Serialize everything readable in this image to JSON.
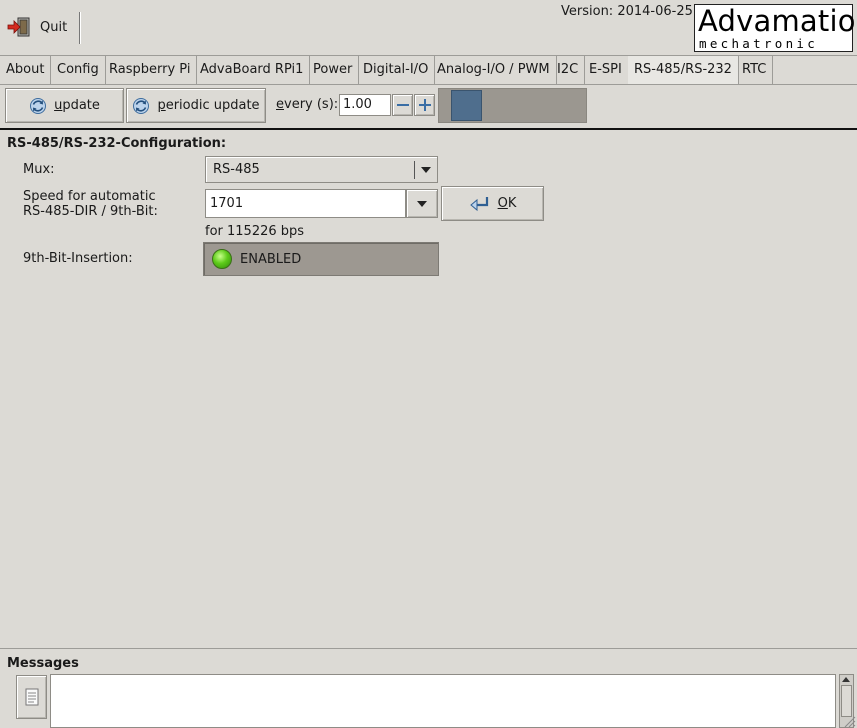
{
  "toolbar": {
    "quit_label": "Quit",
    "version": "Version: 2014-06-25",
    "logo_line1": "Advamation",
    "logo_line2": "mechatronic"
  },
  "tabs": [
    {
      "label": "About"
    },
    {
      "label": "Config"
    },
    {
      "label": "Raspberry Pi"
    },
    {
      "label": "AdvaBoard RPi1"
    },
    {
      "label": "Power"
    },
    {
      "label": "Digital-I/O"
    },
    {
      "label": "Analog-I/O / PWM"
    },
    {
      "label": "I2C"
    },
    {
      "label": "E-SPI"
    },
    {
      "label": "RS-485/RS-232",
      "active": true
    },
    {
      "label": "RTC"
    }
  ],
  "update_bar": {
    "update_label": "update",
    "periodic_label": "periodic update",
    "every_label": "every (s):",
    "interval_value": "1.00",
    "slider_level": 0.1
  },
  "config": {
    "section_title": "RS-485/RS-232-Configuration:",
    "mux_label": "Mux:",
    "mux_value": "RS-485",
    "speed_label_line1": "Speed for automatic",
    "speed_label_line2": "RS-485-DIR / 9th-Bit:",
    "speed_value": "1701",
    "ok_label": "OK",
    "bps_text": "for 115226 bps",
    "ninth_bit_label": "9th-Bit-Insertion:",
    "ninth_bit_state": "ENABLED"
  },
  "messages": {
    "title": "Messages",
    "text": ""
  },
  "colors": {
    "background": "#dcdad5",
    "slider_knob": "#4f6e8d",
    "led_on": "#5ecb1a"
  }
}
